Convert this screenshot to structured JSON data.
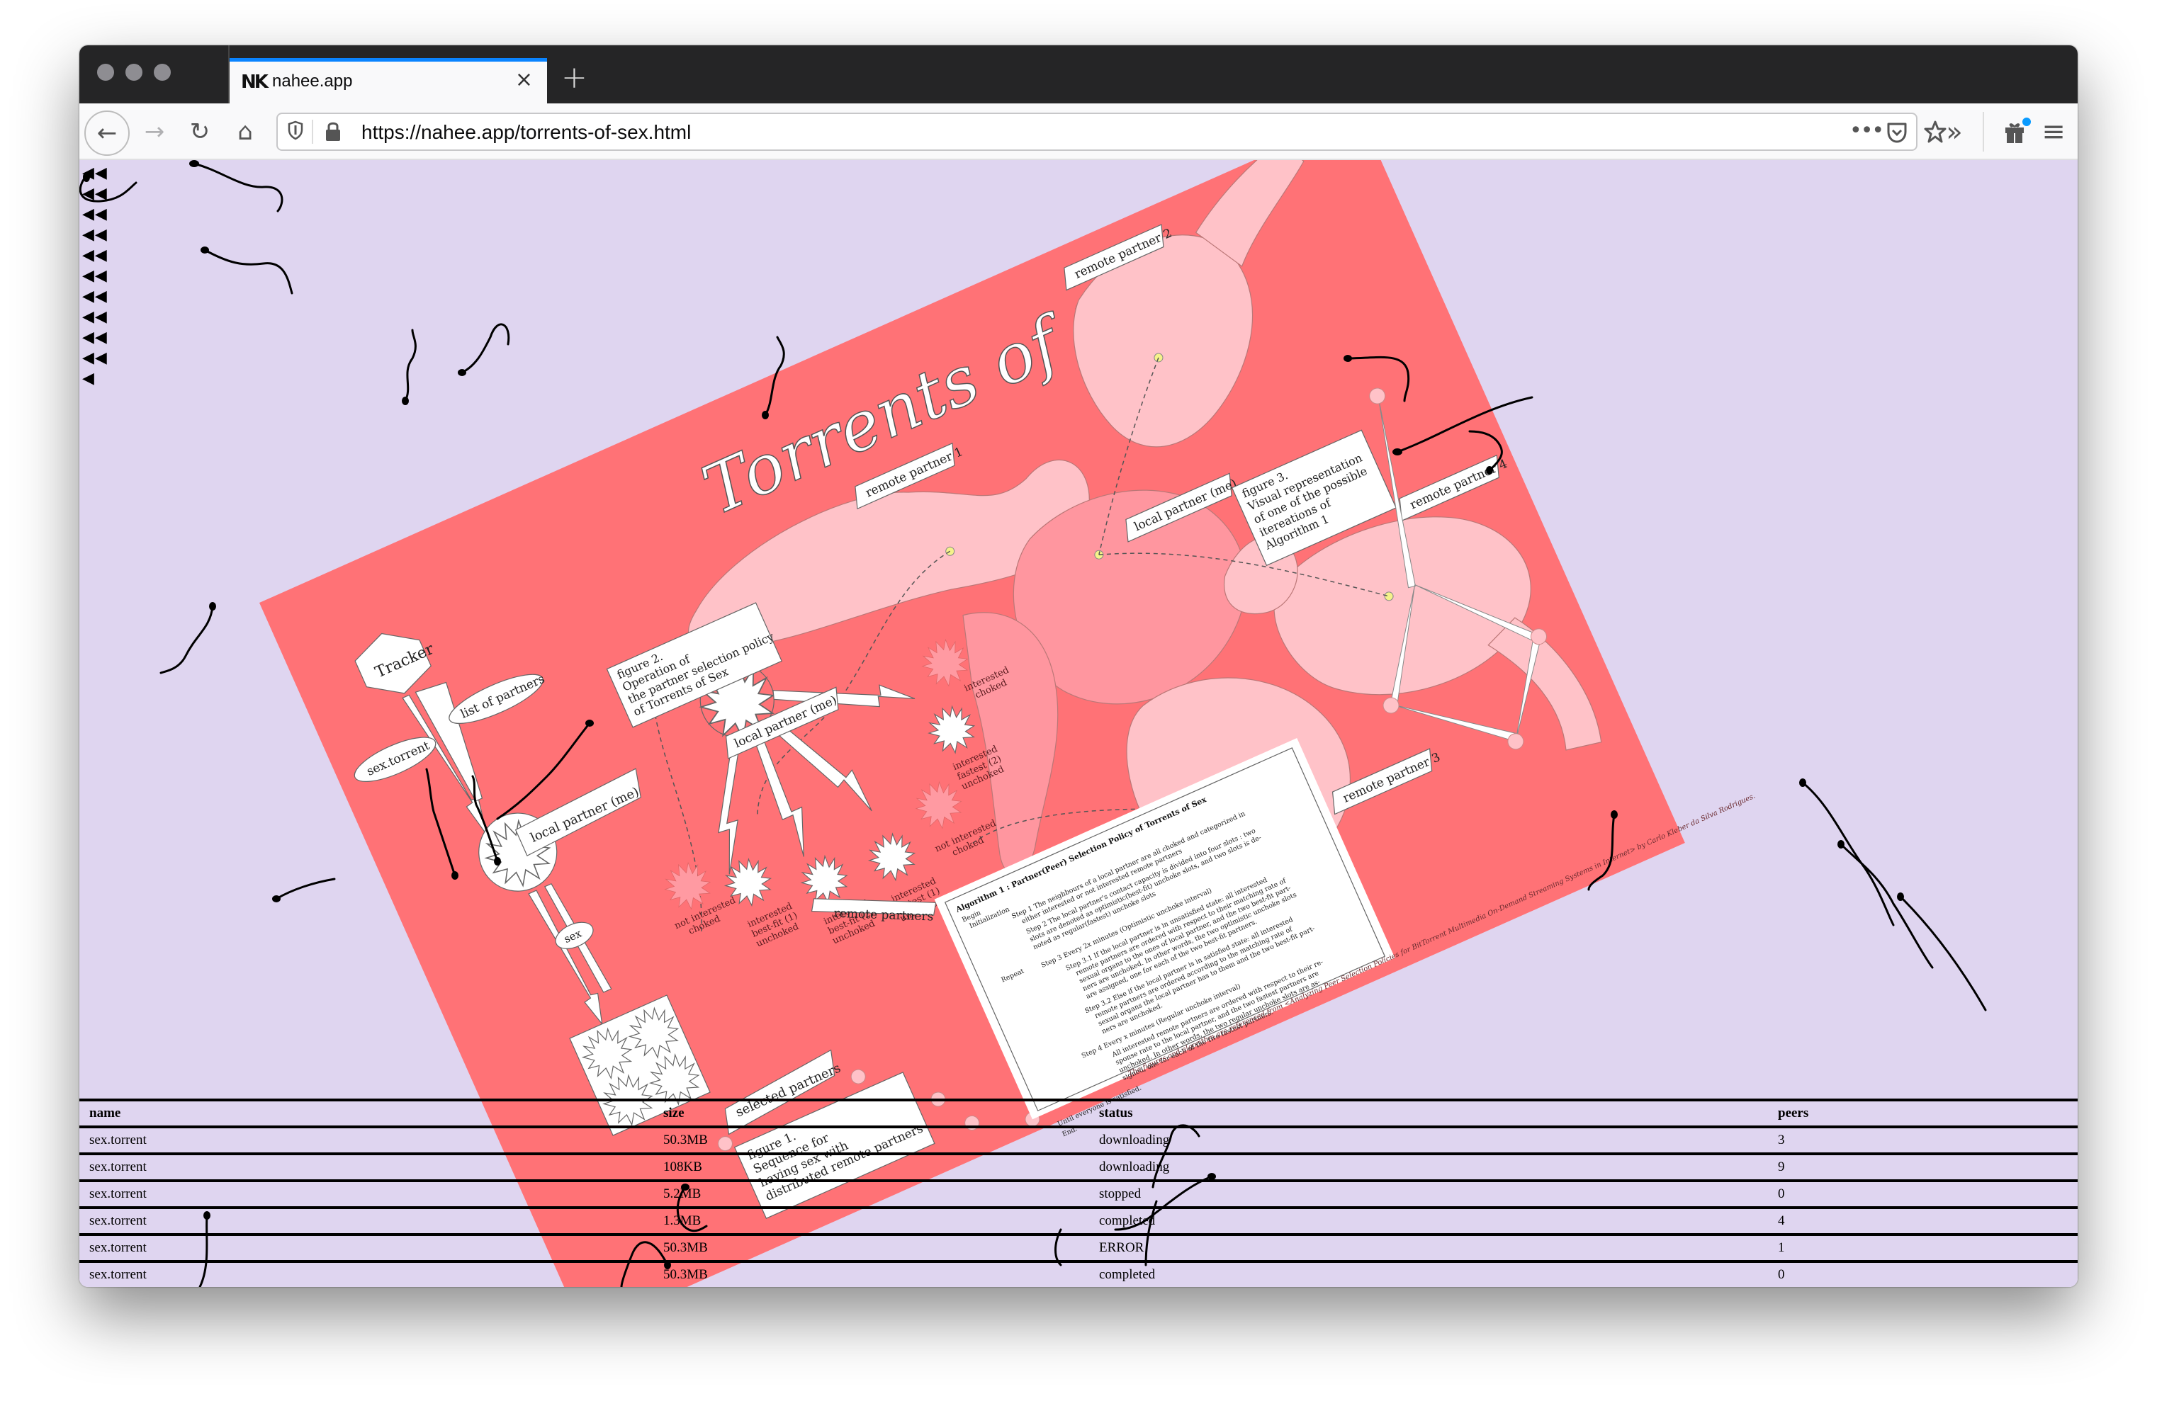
{
  "browser": {
    "tab": {
      "favicon": "NK",
      "title": "nahee.app",
      "close_icon": "×"
    },
    "new_tab_label": "+",
    "url": "https://nahee.app/torrents-of-sex.html",
    "icons": {
      "back": "←",
      "forward": "→",
      "reload": "↻",
      "home": "⌂",
      "page_actions": "•••",
      "overflow": "»",
      "menu": "≡"
    }
  },
  "colors": {
    "page_background": "#dfd5f0",
    "poster_red": "#ff7276",
    "figure_pink": "#ffc2c8",
    "figure_pink_dark": "#ff969f",
    "tab_accent": "#0a84ff",
    "notification_dot": "#0a9bff"
  },
  "arrow_column": {
    "rows": [
      "◀◀",
      "◀◀",
      "◀◀",
      "◀◀",
      "◀◀",
      "◀◀",
      "◀◀",
      "◀◀",
      "◀◀",
      "◀◀",
      "◀"
    ]
  },
  "poster": {
    "title": "Torrents of Sex",
    "labels": {
      "remote_partner_1": "remote partner 1",
      "remote_partner_2": "remote partner 2",
      "remote_partner_3": "remote partner 3",
      "remote_partner_4": "remote partner 4",
      "local_partner_top": "local partner (me)",
      "local_partner_fig2": "local partner (me)",
      "local_partner_fig1": "local partner (me)",
      "tracker": "Tracker",
      "sex_torrent": "sex.torrent",
      "list_of_partners": "list of partners",
      "sex": "sex",
      "remote_partners": "remote partners",
      "selected_partners": "selected partners"
    },
    "figure1": [
      "figure 1.",
      "Sequence for",
      "having sex with",
      "distributed remote partners"
    ],
    "figure2": [
      "figure 2.",
      "Operation of",
      "the partner selection policy",
      "of Torrents of Sex"
    ],
    "figure3": [
      "figure 3.",
      "Visual representation",
      "of one of the possible",
      "itereations of",
      "Algorithm 1"
    ],
    "states": [
      [
        "not interested",
        "choked"
      ],
      [
        "interested",
        "best-fit (1)",
        "unchoked"
      ],
      [
        "interested",
        "best-fit (2)",
        "unchoked"
      ],
      [
        "interested",
        "fastest (1)",
        "unchoked"
      ],
      [
        "not interested",
        "choked"
      ],
      [
        "interested",
        "fastest (2)",
        "unchoked"
      ],
      [
        "interested",
        "choked"
      ]
    ],
    "algorithm": {
      "title": "Algorithm 1 : Partner(Peer) Selection Policy of Torrents of Sex",
      "lines": [
        "Begin",
        "Initialization",
        "Step 1  The neighbours of a local partner are all choked and categorized in",
        "either interested or not interested remote partners",
        "Step 2  The local partner's contact capacity is divided into four slots : two",
        "slots are denoted as optimistic(best-fit) unchoke slots, and two slots is de-",
        "noted as regular(fastest) unchoke slots",
        "Repeat",
        "Step 3  Every 2x minutes (Optimistic unchoke interval)",
        "Step 3.1  If the local partner is in unsatisfied state: all interested",
        "remote partners are ordered with respect to their matching rate of",
        "sexual organs to the ones of local partner, and the two best-fit part-",
        "ners are unchoked. In other words, the two optimistic unchoke slots",
        "are assigned, one for each of the two best-fit partners.",
        "Step 3.2  Else if the local partner is in satisfied state: all interested",
        "remote partners are ordered according to the matching rate of",
        "sexual organs the local partner has to them and the two best-fit part-",
        "ners are unchoked.",
        "Step 4  Every x minutes (Regular unchoke interval)",
        "All interested remote partners are ordered with respect to their re-",
        "sponse rate to the local partner, and the two fastest partners are",
        "unchoked. In other words, the two regular unchoke slots are as-",
        "signed, one for each of the two fastest partners.",
        "Until everyone is satisfied.",
        "End."
      ]
    },
    "credit": "The figures and algorithm are referenced from <Analyzing Peer Selection Policies for BitTorrent Multimedia On-Demand Streaming Systems in Internet> by Carlo Kleber da Silva Rodrigues."
  },
  "table": {
    "headers": {
      "name": "name",
      "size": "size",
      "status": "status",
      "peers": "peers"
    },
    "rows": [
      {
        "name": "sex.torrent",
        "size": "50.3MB",
        "status": "downloading",
        "peers": "3"
      },
      {
        "name": "sex.torrent",
        "size": "108KB",
        "status": "downloading",
        "peers": "9"
      },
      {
        "name": "sex.torrent",
        "size": "5.2MB",
        "status": "stopped",
        "peers": "0"
      },
      {
        "name": "sex.torrent",
        "size": "1.3MB",
        "status": "completed",
        "peers": "4"
      },
      {
        "name": "sex.torrent",
        "size": "50.3MB",
        "status": "ERROR",
        "peers": "1"
      },
      {
        "name": "sex.torrent",
        "size": "50.3MB",
        "status": "completed",
        "peers": "0"
      }
    ]
  }
}
